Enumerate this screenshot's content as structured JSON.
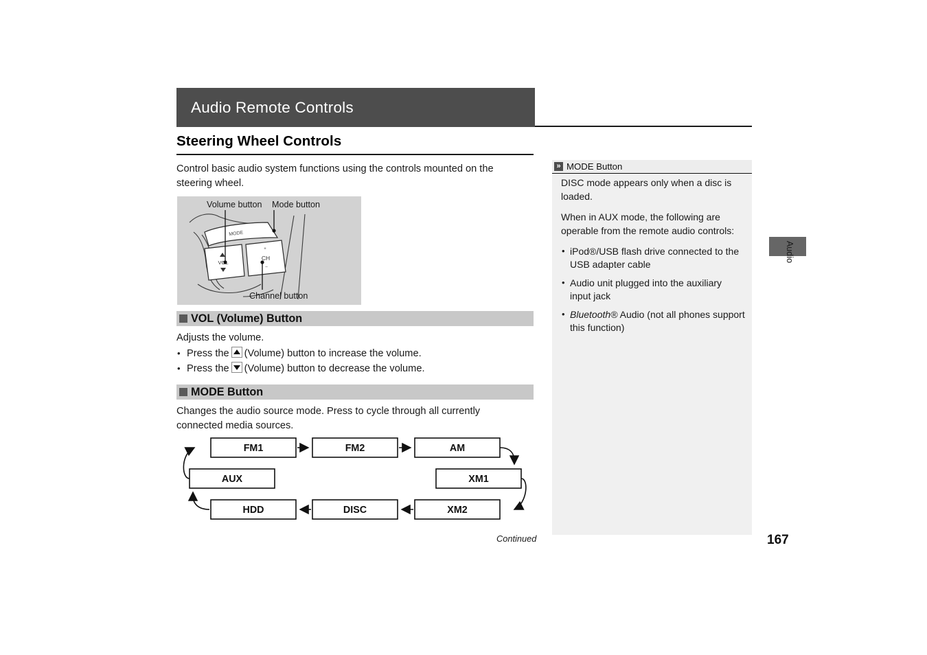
{
  "chapter": {
    "title": "Audio Remote Controls"
  },
  "section": {
    "title": "Steering Wheel Controls"
  },
  "intro": "Control basic audio system functions using the controls mounted on the steering wheel.",
  "illustration": {
    "labels": {
      "volume": "Volume button",
      "mode": "Mode button",
      "channel": "Channel button"
    },
    "button_glyphs": {
      "mode": "MODE",
      "vol": "VOL",
      "ch": "CH"
    },
    "background_color": "#d2d2d2"
  },
  "vol_section": {
    "heading": "VOL (Volume) Button",
    "intro": "Adjusts the volume.",
    "bullets": [
      {
        "pre": "Press the",
        "icon": "triangle-up-icon",
        "post": "(Volume) button to increase the volume."
      },
      {
        "pre": "Press the",
        "icon": "triangle-down-icon",
        "post": "(Volume) button to decrease the volume."
      }
    ]
  },
  "mode_section": {
    "heading": "MODE Button",
    "intro": "Changes the audio source mode. Press to cycle through all currently connected media sources."
  },
  "chart_data": {
    "type": "diagram",
    "title": "Audio source mode cycle",
    "nodes": [
      "FM1",
      "FM2",
      "AM",
      "XM1",
      "XM2",
      "DISC",
      "HDD",
      "AUX"
    ],
    "edges": [
      [
        "AUX",
        "FM1"
      ],
      [
        "FM1",
        "FM2"
      ],
      [
        "FM2",
        "AM"
      ],
      [
        "AM",
        "XM1"
      ],
      [
        "XM1",
        "XM2"
      ],
      [
        "XM2",
        "DISC"
      ],
      [
        "DISC",
        "HDD"
      ],
      [
        "HDD",
        "AUX"
      ]
    ],
    "labels": {
      "fm1": "FM1",
      "fm2": "FM2",
      "am": "AM",
      "xm1": "XM1",
      "xm2": "XM2",
      "disc": "DISC",
      "hdd": "HDD",
      "aux": "AUX"
    }
  },
  "note": {
    "icon": "double-chevron-icon",
    "icon_glyph": "»",
    "title": "MODE Button",
    "paragraphs": [
      "DISC mode appears only when a disc is loaded.",
      "When in AUX mode, the following are operable from the remote audio controls:"
    ],
    "bullets": [
      {
        "text": "iPod®/USB flash drive connected to the USB adapter cable"
      },
      {
        "text": "Audio unit plugged into the auxiliary input jack"
      },
      {
        "italic": "Bluetooth®",
        "text": " Audio (not all phones support this function)"
      }
    ]
  },
  "edge_tab": {
    "label": "Audio",
    "color": "#666666"
  },
  "footer": {
    "continued": "Continued",
    "page_number": "167"
  },
  "colors": {
    "chapter_bar": "#4d4d4d",
    "band": "#c8c8c8",
    "note_bg": "#f0f0f0",
    "illustration_bg": "#d2d2d2"
  }
}
